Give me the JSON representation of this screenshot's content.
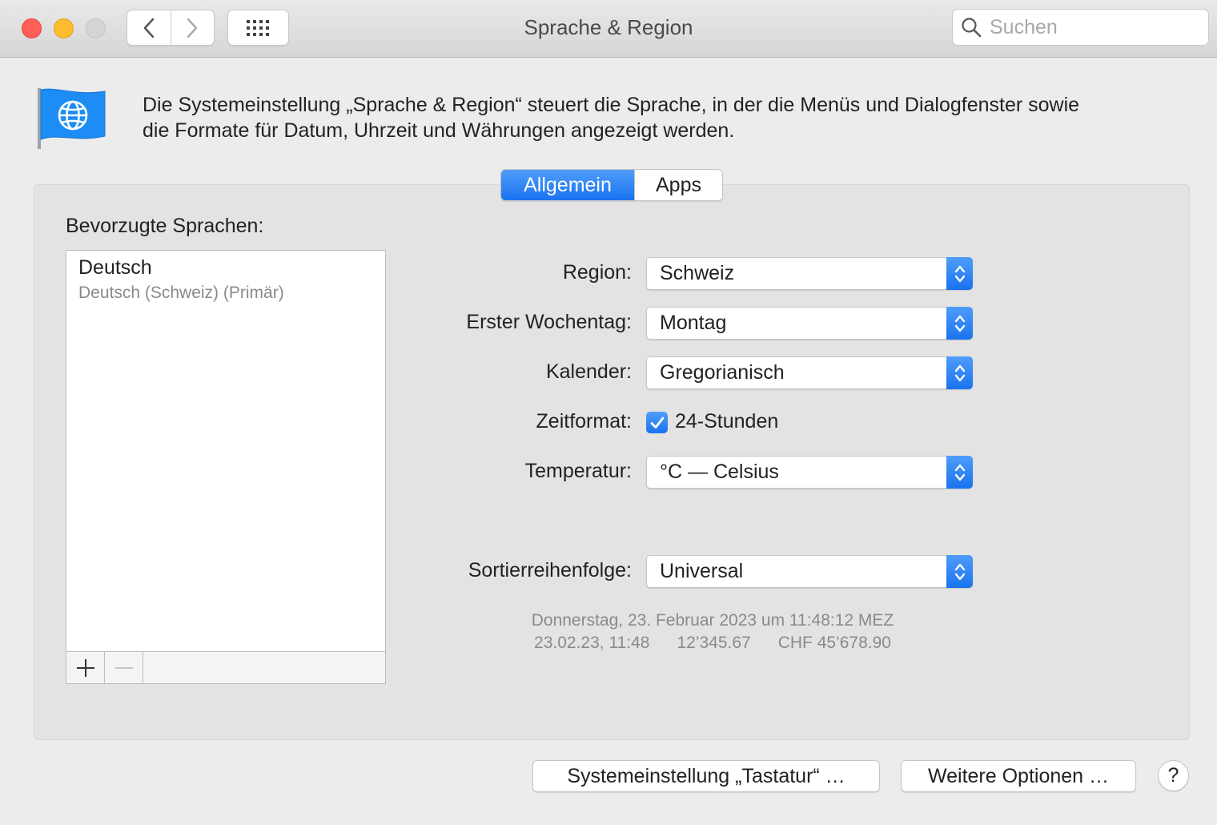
{
  "window": {
    "title": "Sprache & Region",
    "search_placeholder": "Suchen"
  },
  "header": {
    "description_line1": "Die Systemeinstellung „Sprache & Region“ steuert die Sprache, in der die Menüs und Dialogfenster sowie",
    "description_line2": "die Formate für Datum, Uhrzeit und Währungen angezeigt werden.",
    "icon": "globe-flag-icon"
  },
  "tabs": {
    "general": "Allgemein",
    "apps": "Apps",
    "active": "Allgemein"
  },
  "languages": {
    "label": "Bevorzugte Sprachen:",
    "items": [
      {
        "name": "Deutsch",
        "detail": "Deutsch (Schweiz) (Primär)"
      }
    ],
    "add_label": "+",
    "remove_label": "—"
  },
  "settings": {
    "region": {
      "label": "Region:",
      "value": "Schweiz"
    },
    "first_weekday": {
      "label": "Erster Wochentag:",
      "value": "Montag"
    },
    "calendar": {
      "label": "Kalender:",
      "value": "Gregorianisch"
    },
    "time_format": {
      "label": "Zeitformat:",
      "checkbox_label": "24-Stunden",
      "checked": true
    },
    "temperature": {
      "label": "Temperatur:",
      "value": "°C — Celsius"
    },
    "sort_order": {
      "label": "Sortierreihenfolge:",
      "value": "Universal"
    }
  },
  "preview": {
    "line1": "Donnerstag, 23. Februar 2023 um 11:48:12 MEZ",
    "date_short": "23.02.23, 11:48",
    "number": "12’345.67",
    "currency": "CHF 45’678.90"
  },
  "buttons": {
    "keyboard": "Systemeinstellung „Tastatur“ …",
    "more_options": "Weitere Optionen …",
    "help": "?"
  },
  "colors": {
    "accent": "#1a73ef",
    "close": "#ff5f57",
    "minimize": "#febc2e",
    "background": "#ececec"
  }
}
